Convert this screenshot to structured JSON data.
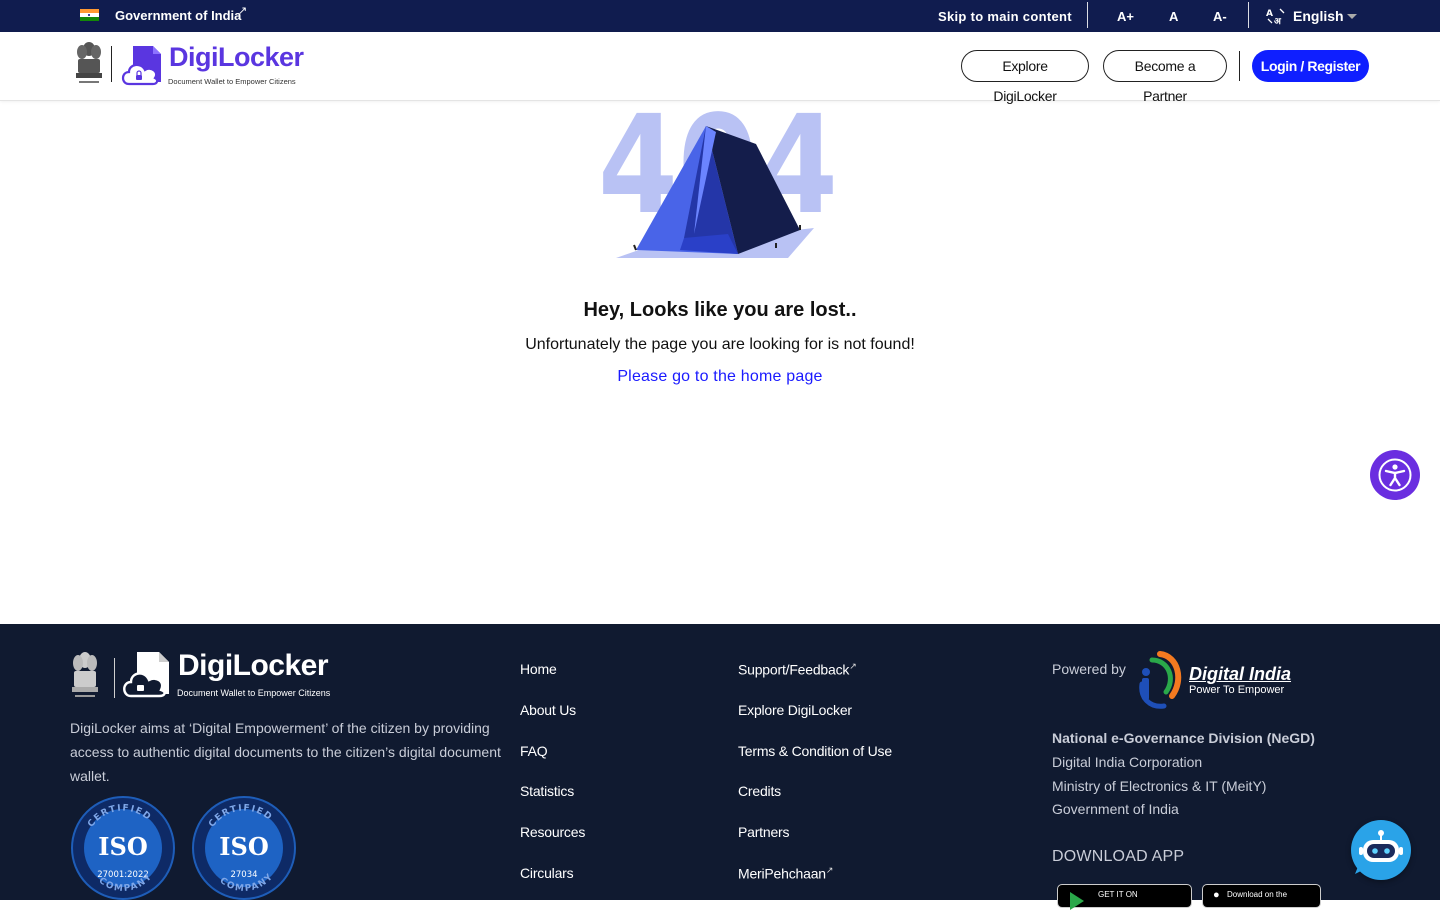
{
  "gov_bar": {
    "gov_label": "Government of India",
    "skip_label": "Skip to main content",
    "font_increase": "A+",
    "font_normal": "A",
    "font_decrease": "A-",
    "language": "English"
  },
  "header": {
    "logo_title": "DigiLocker",
    "logo_tagline": "Document Wallet to Empower Citizens",
    "explore_button": "Explore DigiLocker",
    "partner_button": "Become a Partner",
    "login_button": "Login / Register"
  },
  "error_page": {
    "illustration_code": "404",
    "title": "Hey, Looks like you are lost..",
    "message": "Unfortunately the page you are looking for is not found!",
    "home_link": "Please go to the home page"
  },
  "footer": {
    "logo_title": "DigiLocker",
    "logo_tagline": "Document Wallet to Empower Citizens",
    "about": "DigiLocker aims at ‘Digital Empowerment’ of the citizen by providing access to authentic digital documents to the citizen’s digital document wallet.",
    "iso_badges": [
      {
        "top": "CERTIFIED",
        "mark": "ISO",
        "standard": "27001:2022",
        "bottom": "COMPANY"
      },
      {
        "top": "CERTIFIED",
        "mark": "ISO",
        "standard": "27034",
        "bottom": "COMPANY"
      }
    ],
    "links_col1": [
      "Home",
      "About Us",
      "FAQ",
      "Statistics",
      "Resources",
      "Circulars"
    ],
    "links_col2": [
      "Support/Feedback",
      "Explore DigiLocker",
      "Terms & Condition of Use",
      "Credits",
      "Partners",
      "MeriPehchaan"
    ],
    "powered_by": "Powered by",
    "digital_india": "Digital India",
    "digital_india_tagline": "Power To Empower",
    "negd": "National e-Governance Division (NeGD)",
    "org_lines": [
      "Digital India Corporation",
      "Ministry of Electronics & IT (MeitY)",
      "Government of India"
    ],
    "download_title": "DOWNLOAD APP",
    "google_play": "GET IT ON",
    "app_store": "Download on the"
  },
  "colors": {
    "gov_bar_bg": "#101c4f",
    "brand_purple": "#5a36e0",
    "login_blue": "#0f1fff",
    "link_blue": "#1a1aff",
    "footer_bg": "#101a30",
    "accessibility_purple": "#6a2ee0",
    "chatbot_blue": "#2aa3e8"
  },
  "icons": [
    "india-flag-icon",
    "external-link-icon",
    "translate-icon",
    "chevron-down-icon",
    "national-emblem-icon",
    "digilocker-logo-icon",
    "tent-404-illustration",
    "accessibility-icon",
    "digital-india-logo-icon",
    "google-play-icon",
    "apple-icon",
    "chatbot-icon"
  ]
}
